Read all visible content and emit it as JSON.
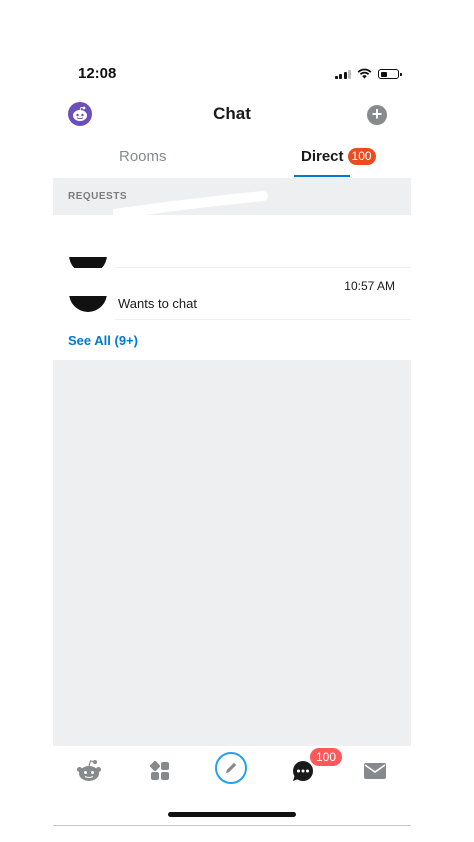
{
  "status_bar": {
    "time": "12:08"
  },
  "header": {
    "title": "Chat"
  },
  "tabs": [
    {
      "label": "Rooms"
    },
    {
      "label": "Direct",
      "badge": "100"
    }
  ],
  "requests": {
    "section_label": "REQUESTS",
    "rows": [
      {
        "name": "",
        "time": "",
        "subtitle": ""
      },
      {
        "name": "",
        "time": "10:57 AM",
        "subtitle": "Wants to chat"
      }
    ],
    "see_all": "See All (9+)"
  },
  "bottom_nav": {
    "items": [
      {
        "icon": "reddit-home-icon"
      },
      {
        "icon": "communities-icon"
      },
      {
        "icon": "compose-icon"
      },
      {
        "icon": "chat-icon",
        "badge": "100"
      },
      {
        "icon": "inbox-icon"
      }
    ]
  },
  "colors": {
    "accent_blue": "#0079d3",
    "badge_orange": "#ea4b1f",
    "badge_red": "#ff585b",
    "background_gray": "#edeff1"
  }
}
